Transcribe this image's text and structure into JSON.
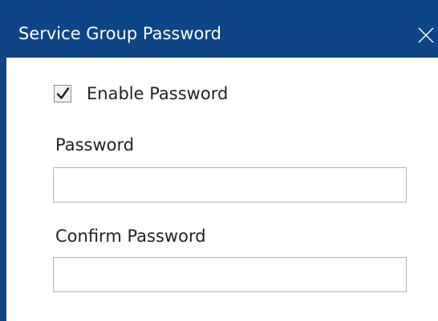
{
  "dialog": {
    "title": "Service Group Password",
    "close_icon": "close-icon"
  },
  "enable_password": {
    "label": "Enable Password",
    "checked": true,
    "check_icon": "checkmark-icon"
  },
  "password": {
    "label": "Password",
    "value": ""
  },
  "confirm_password": {
    "label": "Confirm Password",
    "value": ""
  },
  "colors": {
    "titlebar": "#0e4586",
    "title_text": "#ffffff",
    "label_text": "#222222",
    "input_border": "#b4b4b4"
  }
}
